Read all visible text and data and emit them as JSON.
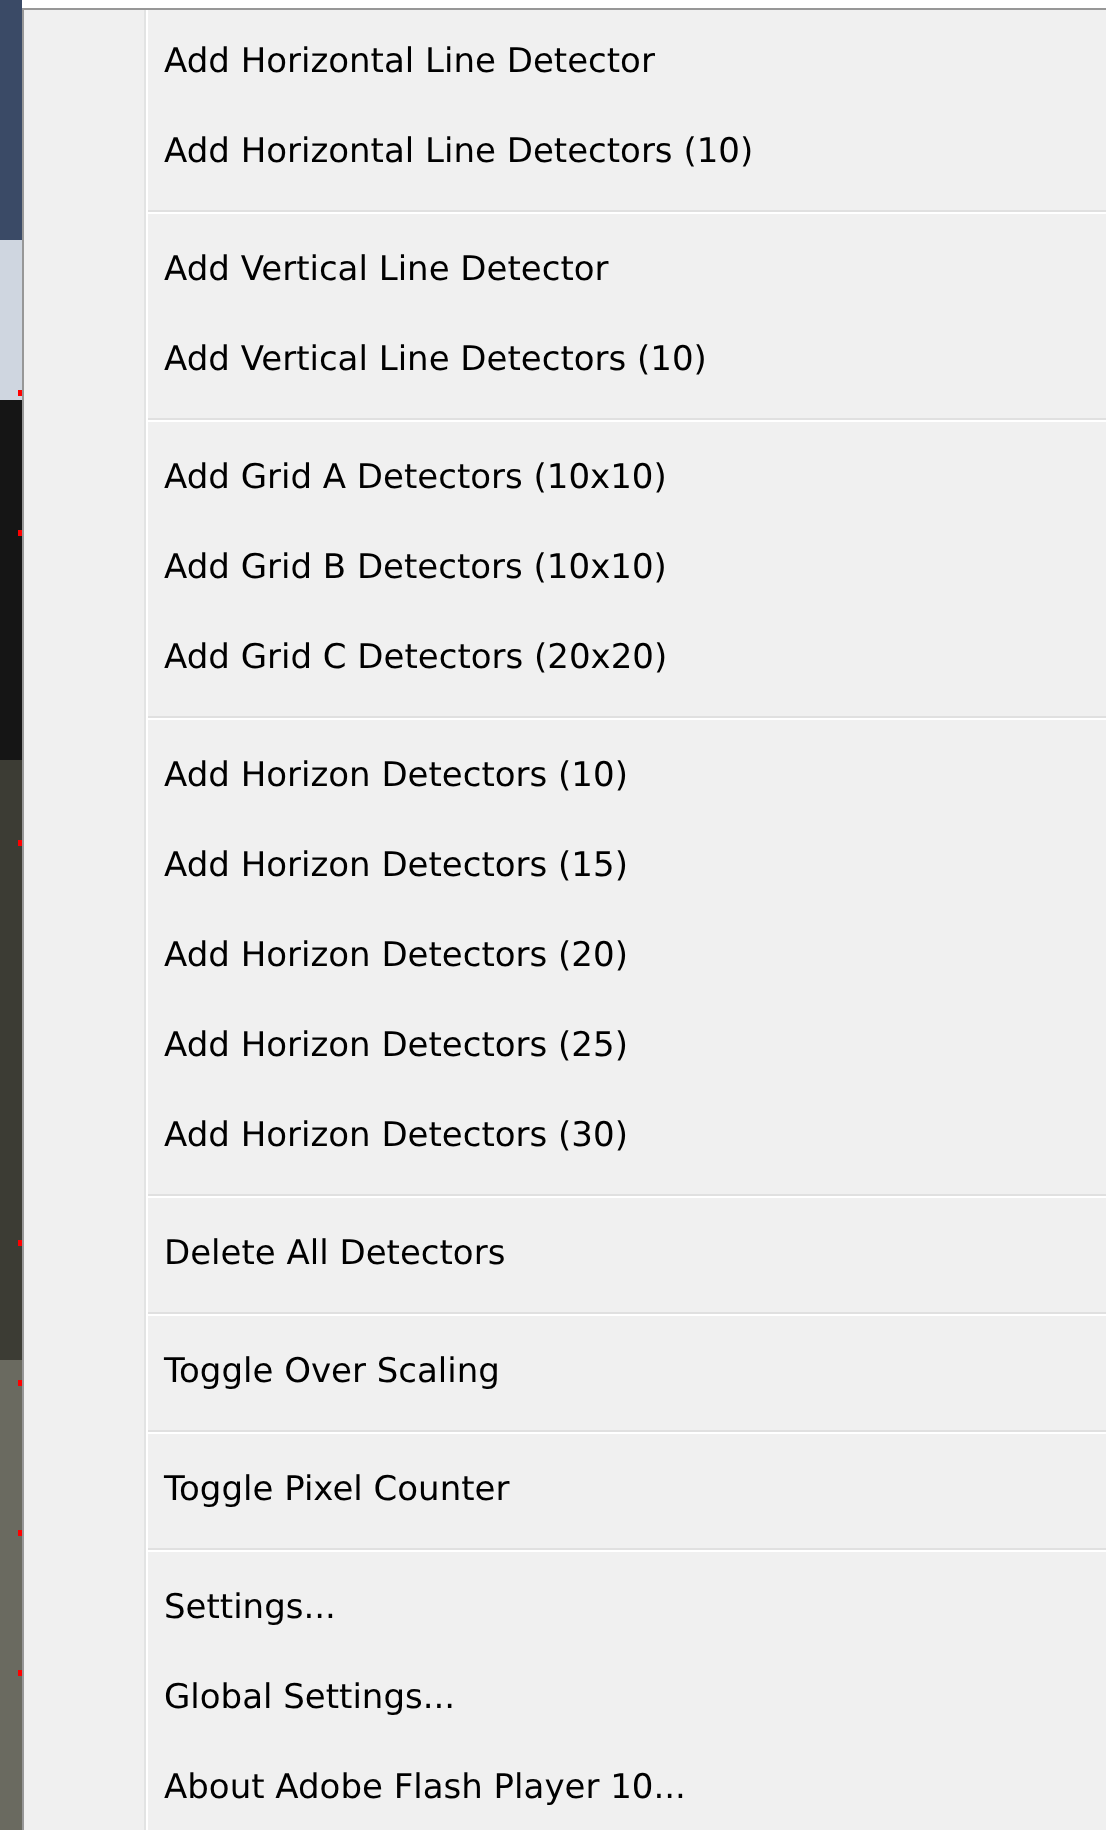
{
  "context_menu": {
    "groups": [
      {
        "items": [
          "Add Horizontal Line Detector",
          "Add Horizontal Line Detectors (10)"
        ]
      },
      {
        "items": [
          "Add Vertical Line Detector",
          "Add Vertical Line Detectors (10)"
        ]
      },
      {
        "items": [
          "Add Grid A Detectors (10x10)",
          "Add Grid B Detectors (10x10)",
          "Add Grid C Detectors (20x20)"
        ]
      },
      {
        "items": [
          "Add Horizon Detectors (10)",
          "Add Horizon Detectors (15)",
          "Add Horizon Detectors (20)",
          "Add Horizon Detectors (25)",
          "Add Horizon Detectors (30)"
        ]
      },
      {
        "items": [
          "Delete All Detectors"
        ]
      },
      {
        "items": [
          "Toggle Over Scaling"
        ]
      },
      {
        "items": [
          "Toggle Pixel Counter"
        ]
      },
      {
        "items": [
          "Settings...",
          "Global Settings...",
          "About Adobe Flash Player 10..."
        ]
      }
    ]
  }
}
